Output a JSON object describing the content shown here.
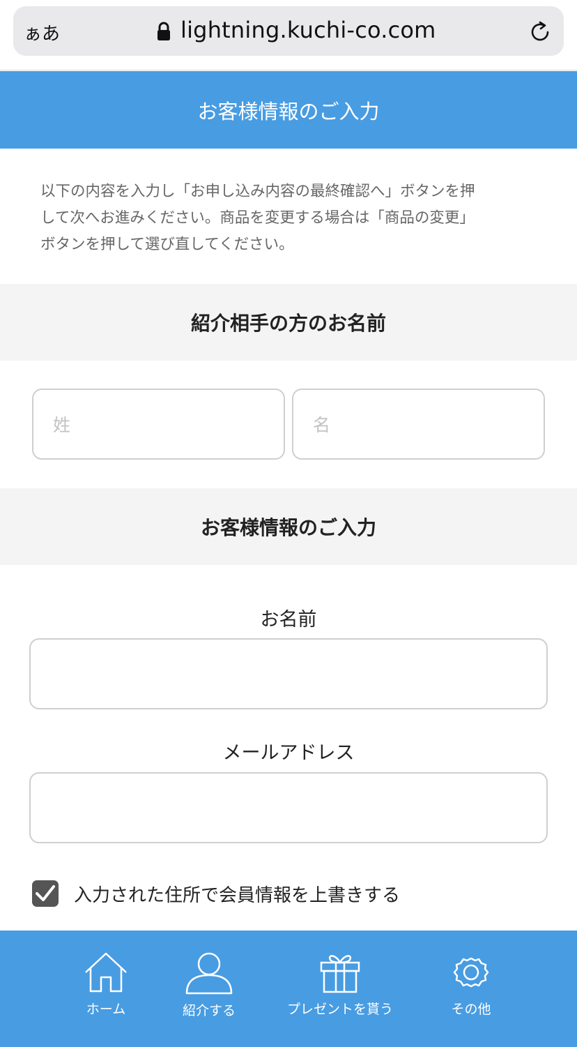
{
  "browser": {
    "text_size_button": "ぁあ",
    "url": "lightning.kuchi-co.com"
  },
  "header": {
    "title": "お客様情報のご入力"
  },
  "intro": {
    "lines": [
      "以下の内容を入力し「お申し込み内容の最終確認へ」ボタンを押",
      "して次へお進みください。商品を変更する場合は「商品の変更」",
      "ボタンを押して選び直してください。"
    ]
  },
  "referral_section": {
    "title": "紹介相手の方のお名前",
    "last_name_placeholder": "姓",
    "first_name_placeholder": "名"
  },
  "customer_section": {
    "title": "お客様情報のご入力",
    "name_label": "お名前",
    "email_label": "メールアドレス"
  },
  "overwrite_checkbox": {
    "label": "入力された住所で会員情報を上書きする",
    "checked": true
  },
  "tabbar": {
    "items": [
      {
        "label": "ホーム",
        "icon": "home-icon"
      },
      {
        "label": "紹介する",
        "icon": "person-icon"
      },
      {
        "label": "プレゼントを貰う",
        "icon": "gift-icon"
      },
      {
        "label": "その他",
        "icon": "gear-icon"
      }
    ]
  },
  "colors": {
    "accent": "#489ce2",
    "section_bg": "#f4f4f4"
  }
}
